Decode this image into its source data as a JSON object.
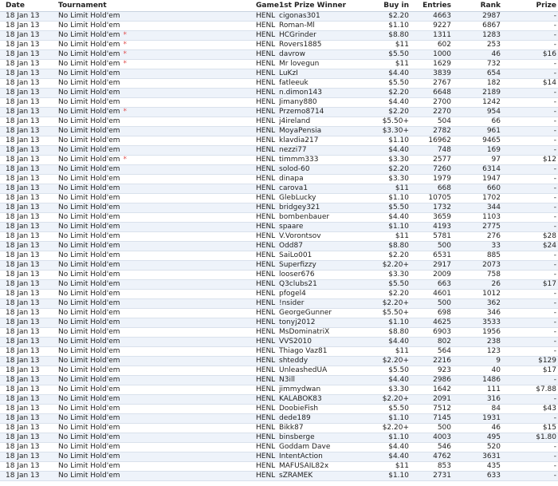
{
  "table": {
    "headers": {
      "date": "Date",
      "tournament": "Tournament",
      "game": "Game",
      "winner": "1st Prize Winner",
      "buyin": "Buy in",
      "entries": "Entries",
      "rank": "Rank",
      "prize": "Prize"
    },
    "rows": [
      {
        "date": "18 Jan 13",
        "tournament": "No Limit Hold'em",
        "star": "",
        "game": "HENL",
        "winner": "cigonas301",
        "buyin": "$2.20",
        "entries": "4663",
        "rank": "2987",
        "prize": "-"
      },
      {
        "date": "18 Jan 13",
        "tournament": "No Limit Hold'em",
        "star": "",
        "game": "HENL",
        "winner": "Roman-Ml",
        "buyin": "$1.10",
        "entries": "9227",
        "rank": "6867",
        "prize": "-"
      },
      {
        "date": "18 Jan 13",
        "tournament": "No Limit Hold'em",
        "star": "*",
        "game": "HENL",
        "winner": "HCGrinder",
        "buyin": "$8.80",
        "entries": "1311",
        "rank": "1283",
        "prize": "-"
      },
      {
        "date": "18 Jan 13",
        "tournament": "No Limit Hold'em",
        "star": "*",
        "game": "HENL",
        "winner": "Rovers1885",
        "buyin": "$11",
        "entries": "602",
        "rank": "253",
        "prize": "-"
      },
      {
        "date": "18 Jan 13",
        "tournament": "No Limit Hold'em",
        "star": "*",
        "game": "HENL",
        "winner": "davrow",
        "buyin": "$5.50",
        "entries": "1000",
        "rank": "46",
        "prize": "$16"
      },
      {
        "date": "18 Jan 13",
        "tournament": "No Limit Hold'em",
        "star": "*",
        "game": "HENL",
        "winner": "Mr lovegun",
        "buyin": "$11",
        "entries": "1629",
        "rank": "732",
        "prize": "-"
      },
      {
        "date": "18 Jan 13",
        "tournament": "No Limit Hold'em",
        "star": "",
        "game": "HENL",
        "winner": "LuKzI",
        "buyin": "$4.40",
        "entries": "3839",
        "rank": "654",
        "prize": "-"
      },
      {
        "date": "18 Jan 13",
        "tournament": "No Limit Hold'em",
        "star": "",
        "game": "HENL",
        "winner": "fatleeuk",
        "buyin": "$5.50",
        "entries": "2767",
        "rank": "182",
        "prize": "$14"
      },
      {
        "date": "18 Jan 13",
        "tournament": "No Limit Hold'em",
        "star": "",
        "game": "HENL",
        "winner": "n.dimon143",
        "buyin": "$2.20",
        "entries": "6648",
        "rank": "2189",
        "prize": "-"
      },
      {
        "date": "18 Jan 13",
        "tournament": "No Limit Hold'em",
        "star": "",
        "game": "HENL",
        "winner": "Jimany880",
        "buyin": "$4.40",
        "entries": "2700",
        "rank": "1242",
        "prize": "-"
      },
      {
        "date": "18 Jan 13",
        "tournament": "No Limit Hold'em",
        "star": "*",
        "game": "HENL",
        "winner": "Przemo8714",
        "buyin": "$2.20",
        "entries": "2270",
        "rank": "954",
        "prize": "-"
      },
      {
        "date": "18 Jan 13",
        "tournament": "No Limit Hold'em",
        "star": "",
        "game": "HENL",
        "winner": "j4ireland",
        "buyin": "$5.50+",
        "entries": "504",
        "rank": "66",
        "prize": "-"
      },
      {
        "date": "18 Jan 13",
        "tournament": "No Limit Hold'em",
        "star": "",
        "game": "HENL",
        "winner": "MoyaPensia",
        "buyin": "$3.30+",
        "entries": "2782",
        "rank": "961",
        "prize": "-"
      },
      {
        "date": "18 Jan 13",
        "tournament": "No Limit Hold'em",
        "star": "",
        "game": "HENL",
        "winner": "klavdia217",
        "buyin": "$1.10",
        "entries": "16962",
        "rank": "9465",
        "prize": "-"
      },
      {
        "date": "18 Jan 13",
        "tournament": "No Limit Hold'em",
        "star": "",
        "game": "HENL",
        "winner": "nezzi77",
        "buyin": "$4.40",
        "entries": "748",
        "rank": "169",
        "prize": "-"
      },
      {
        "date": "18 Jan 13",
        "tournament": "No Limit Hold'em",
        "star": "*",
        "game": "HENL",
        "winner": "timmm333",
        "buyin": "$3.30",
        "entries": "2577",
        "rank": "97",
        "prize": "$12"
      },
      {
        "date": "18 Jan 13",
        "tournament": "No Limit Hold'em",
        "star": "",
        "game": "HENL",
        "winner": "solod-60",
        "buyin": "$2.20",
        "entries": "7260",
        "rank": "6314",
        "prize": "-"
      },
      {
        "date": "18 Jan 13",
        "tournament": "No Limit Hold'em",
        "star": "",
        "game": "HENL",
        "winner": "dinapa",
        "buyin": "$3.30",
        "entries": "1979",
        "rank": "1947",
        "prize": "-"
      },
      {
        "date": "18 Jan 13",
        "tournament": "No Limit Hold'em",
        "star": "",
        "game": "HENL",
        "winner": "carova1",
        "buyin": "$11",
        "entries": "668",
        "rank": "660",
        "prize": "-"
      },
      {
        "date": "18 Jan 13",
        "tournament": "No Limit Hold'em",
        "star": "",
        "game": "HENL",
        "winner": "GlebLucky",
        "buyin": "$1.10",
        "entries": "10705",
        "rank": "1702",
        "prize": "-"
      },
      {
        "date": "18 Jan 13",
        "tournament": "No Limit Hold'em",
        "star": "",
        "game": "HENL",
        "winner": "bridgey321",
        "buyin": "$5.50",
        "entries": "1732",
        "rank": "344",
        "prize": "-"
      },
      {
        "date": "18 Jan 13",
        "tournament": "No Limit Hold'em",
        "star": "",
        "game": "HENL",
        "winner": "bombenbauer",
        "buyin": "$4.40",
        "entries": "3659",
        "rank": "1103",
        "prize": "-"
      },
      {
        "date": "18 Jan 13",
        "tournament": "No Limit Hold'em",
        "star": "",
        "game": "HENL",
        "winner": "spaare",
        "buyin": "$1.10",
        "entries": "4193",
        "rank": "2775",
        "prize": "-"
      },
      {
        "date": "18 Jan 13",
        "tournament": "No Limit Hold'em",
        "star": "",
        "game": "HENL",
        "winner": "V.Vorontsov",
        "buyin": "$11",
        "entries": "5781",
        "rank": "276",
        "prize": "$28"
      },
      {
        "date": "18 Jan 13",
        "tournament": "No Limit Hold'em",
        "star": "",
        "game": "HENL",
        "winner": "Odd87",
        "buyin": "$8.80",
        "entries": "500",
        "rank": "33",
        "prize": "$24"
      },
      {
        "date": "18 Jan 13",
        "tournament": "No Limit Hold'em",
        "star": "",
        "game": "HENL",
        "winner": "SaiLo001",
        "buyin": "$2.20",
        "entries": "6531",
        "rank": "885",
        "prize": "-"
      },
      {
        "date": "18 Jan 13",
        "tournament": "No Limit Hold'em",
        "star": "",
        "game": "HENL",
        "winner": "Superfizzy",
        "buyin": "$2.20+",
        "entries": "2917",
        "rank": "2073",
        "prize": "-"
      },
      {
        "date": "18 Jan 13",
        "tournament": "No Limit Hold'em",
        "star": "",
        "game": "HENL",
        "winner": "looser676",
        "buyin": "$3.30",
        "entries": "2009",
        "rank": "758",
        "prize": "-"
      },
      {
        "date": "18 Jan 13",
        "tournament": "No Limit Hold'em",
        "star": "",
        "game": "HENL",
        "winner": "Q3clubs21",
        "buyin": "$5.50",
        "entries": "663",
        "rank": "26",
        "prize": "$17"
      },
      {
        "date": "18 Jan 13",
        "tournament": "No Limit Hold'em",
        "star": "",
        "game": "HENL",
        "winner": "pfogel4",
        "buyin": "$2.20",
        "entries": "4601",
        "rank": "1012",
        "prize": "-"
      },
      {
        "date": "18 Jan 13",
        "tournament": "No Limit Hold'em",
        "star": "",
        "game": "HENL",
        "winner": "!nsider",
        "buyin": "$2.20+",
        "entries": "500",
        "rank": "362",
        "prize": "-"
      },
      {
        "date": "18 Jan 13",
        "tournament": "No Limit Hold'em",
        "star": "",
        "game": "HENL",
        "winner": "GeorgeGunner",
        "buyin": "$5.50+",
        "entries": "698",
        "rank": "346",
        "prize": "-"
      },
      {
        "date": "18 Jan 13",
        "tournament": "No Limit Hold'em",
        "star": "",
        "game": "HENL",
        "winner": "tonyj2012",
        "buyin": "$1.10",
        "entries": "4625",
        "rank": "3533",
        "prize": "-"
      },
      {
        "date": "18 Jan 13",
        "tournament": "No Limit Hold'em",
        "star": "",
        "game": "HENL",
        "winner": "MsDominatriX",
        "buyin": "$8.80",
        "entries": "6903",
        "rank": "1956",
        "prize": "-"
      },
      {
        "date": "18 Jan 13",
        "tournament": "No Limit Hold'em",
        "star": "",
        "game": "HENL",
        "winner": "VVS2010",
        "buyin": "$4.40",
        "entries": "802",
        "rank": "238",
        "prize": "-"
      },
      {
        "date": "18 Jan 13",
        "tournament": "No Limit Hold'em",
        "star": "",
        "game": "HENL",
        "winner": "Thiago Vaz81",
        "buyin": "$11",
        "entries": "564",
        "rank": "123",
        "prize": "-"
      },
      {
        "date": "18 Jan 13",
        "tournament": "No Limit Hold'em",
        "star": "",
        "game": "HENL",
        "winner": "shteddy",
        "buyin": "$2.20+",
        "entries": "2216",
        "rank": "9",
        "prize": "$129"
      },
      {
        "date": "18 Jan 13",
        "tournament": "No Limit Hold'em",
        "star": "",
        "game": "HENL",
        "winner": "UnleashedUA",
        "buyin": "$5.50",
        "entries": "923",
        "rank": "40",
        "prize": "$17"
      },
      {
        "date": "18 Jan 13",
        "tournament": "No Limit Hold'em",
        "star": "",
        "game": "HENL",
        "winner": "N3ill",
        "buyin": "$4.40",
        "entries": "2986",
        "rank": "1486",
        "prize": "-"
      },
      {
        "date": "18 Jan 13",
        "tournament": "No Limit Hold'em",
        "star": "",
        "game": "HENL",
        "winner": "jimmydwan",
        "buyin": "$3.30",
        "entries": "1642",
        "rank": "111",
        "prize": "$7.88"
      },
      {
        "date": "18 Jan 13",
        "tournament": "No Limit Hold'em",
        "star": "",
        "game": "HENL",
        "winner": "KALABOK83",
        "buyin": "$2.20+",
        "entries": "2091",
        "rank": "316",
        "prize": "-"
      },
      {
        "date": "18 Jan 13",
        "tournament": "No Limit Hold'em",
        "star": "",
        "game": "HENL",
        "winner": "DoobieFish",
        "buyin": "$5.50",
        "entries": "7512",
        "rank": "84",
        "prize": "$43"
      },
      {
        "date": "18 Jan 13",
        "tournament": "No Limit Hold'em",
        "star": "",
        "game": "HENL",
        "winner": "dede189",
        "buyin": "$1.10",
        "entries": "7145",
        "rank": "1931",
        "prize": "-"
      },
      {
        "date": "18 Jan 13",
        "tournament": "No Limit Hold'em",
        "star": "",
        "game": "HENL",
        "winner": "Bikk87",
        "buyin": "$2.20+",
        "entries": "500",
        "rank": "46",
        "prize": "$15"
      },
      {
        "date": "18 Jan 13",
        "tournament": "No Limit Hold'em",
        "star": "",
        "game": "HENL",
        "winner": "binsberge",
        "buyin": "$1.10",
        "entries": "4003",
        "rank": "495",
        "prize": "$1.80"
      },
      {
        "date": "18 Jan 13",
        "tournament": "No Limit Hold'em",
        "star": "",
        "game": "HENL",
        "winner": "Goddam Dave",
        "buyin": "$4.40",
        "entries": "546",
        "rank": "520",
        "prize": "-"
      },
      {
        "date": "18 Jan 13",
        "tournament": "No Limit Hold'em",
        "star": "",
        "game": "HENL",
        "winner": "IntentAction",
        "buyin": "$4.40",
        "entries": "4762",
        "rank": "3631",
        "prize": "-"
      },
      {
        "date": "18 Jan 13",
        "tournament": "No Limit Hold'em",
        "star": "",
        "game": "HENL",
        "winner": "MAFUSAIL82x",
        "buyin": "$11",
        "entries": "853",
        "rank": "435",
        "prize": "-"
      },
      {
        "date": "18 Jan 13",
        "tournament": "No Limit Hold'em",
        "star": "",
        "game": "HENL",
        "winner": "sZRAMEK",
        "buyin": "$1.10",
        "entries": "2731",
        "rank": "633",
        "prize": "-"
      }
    ]
  }
}
